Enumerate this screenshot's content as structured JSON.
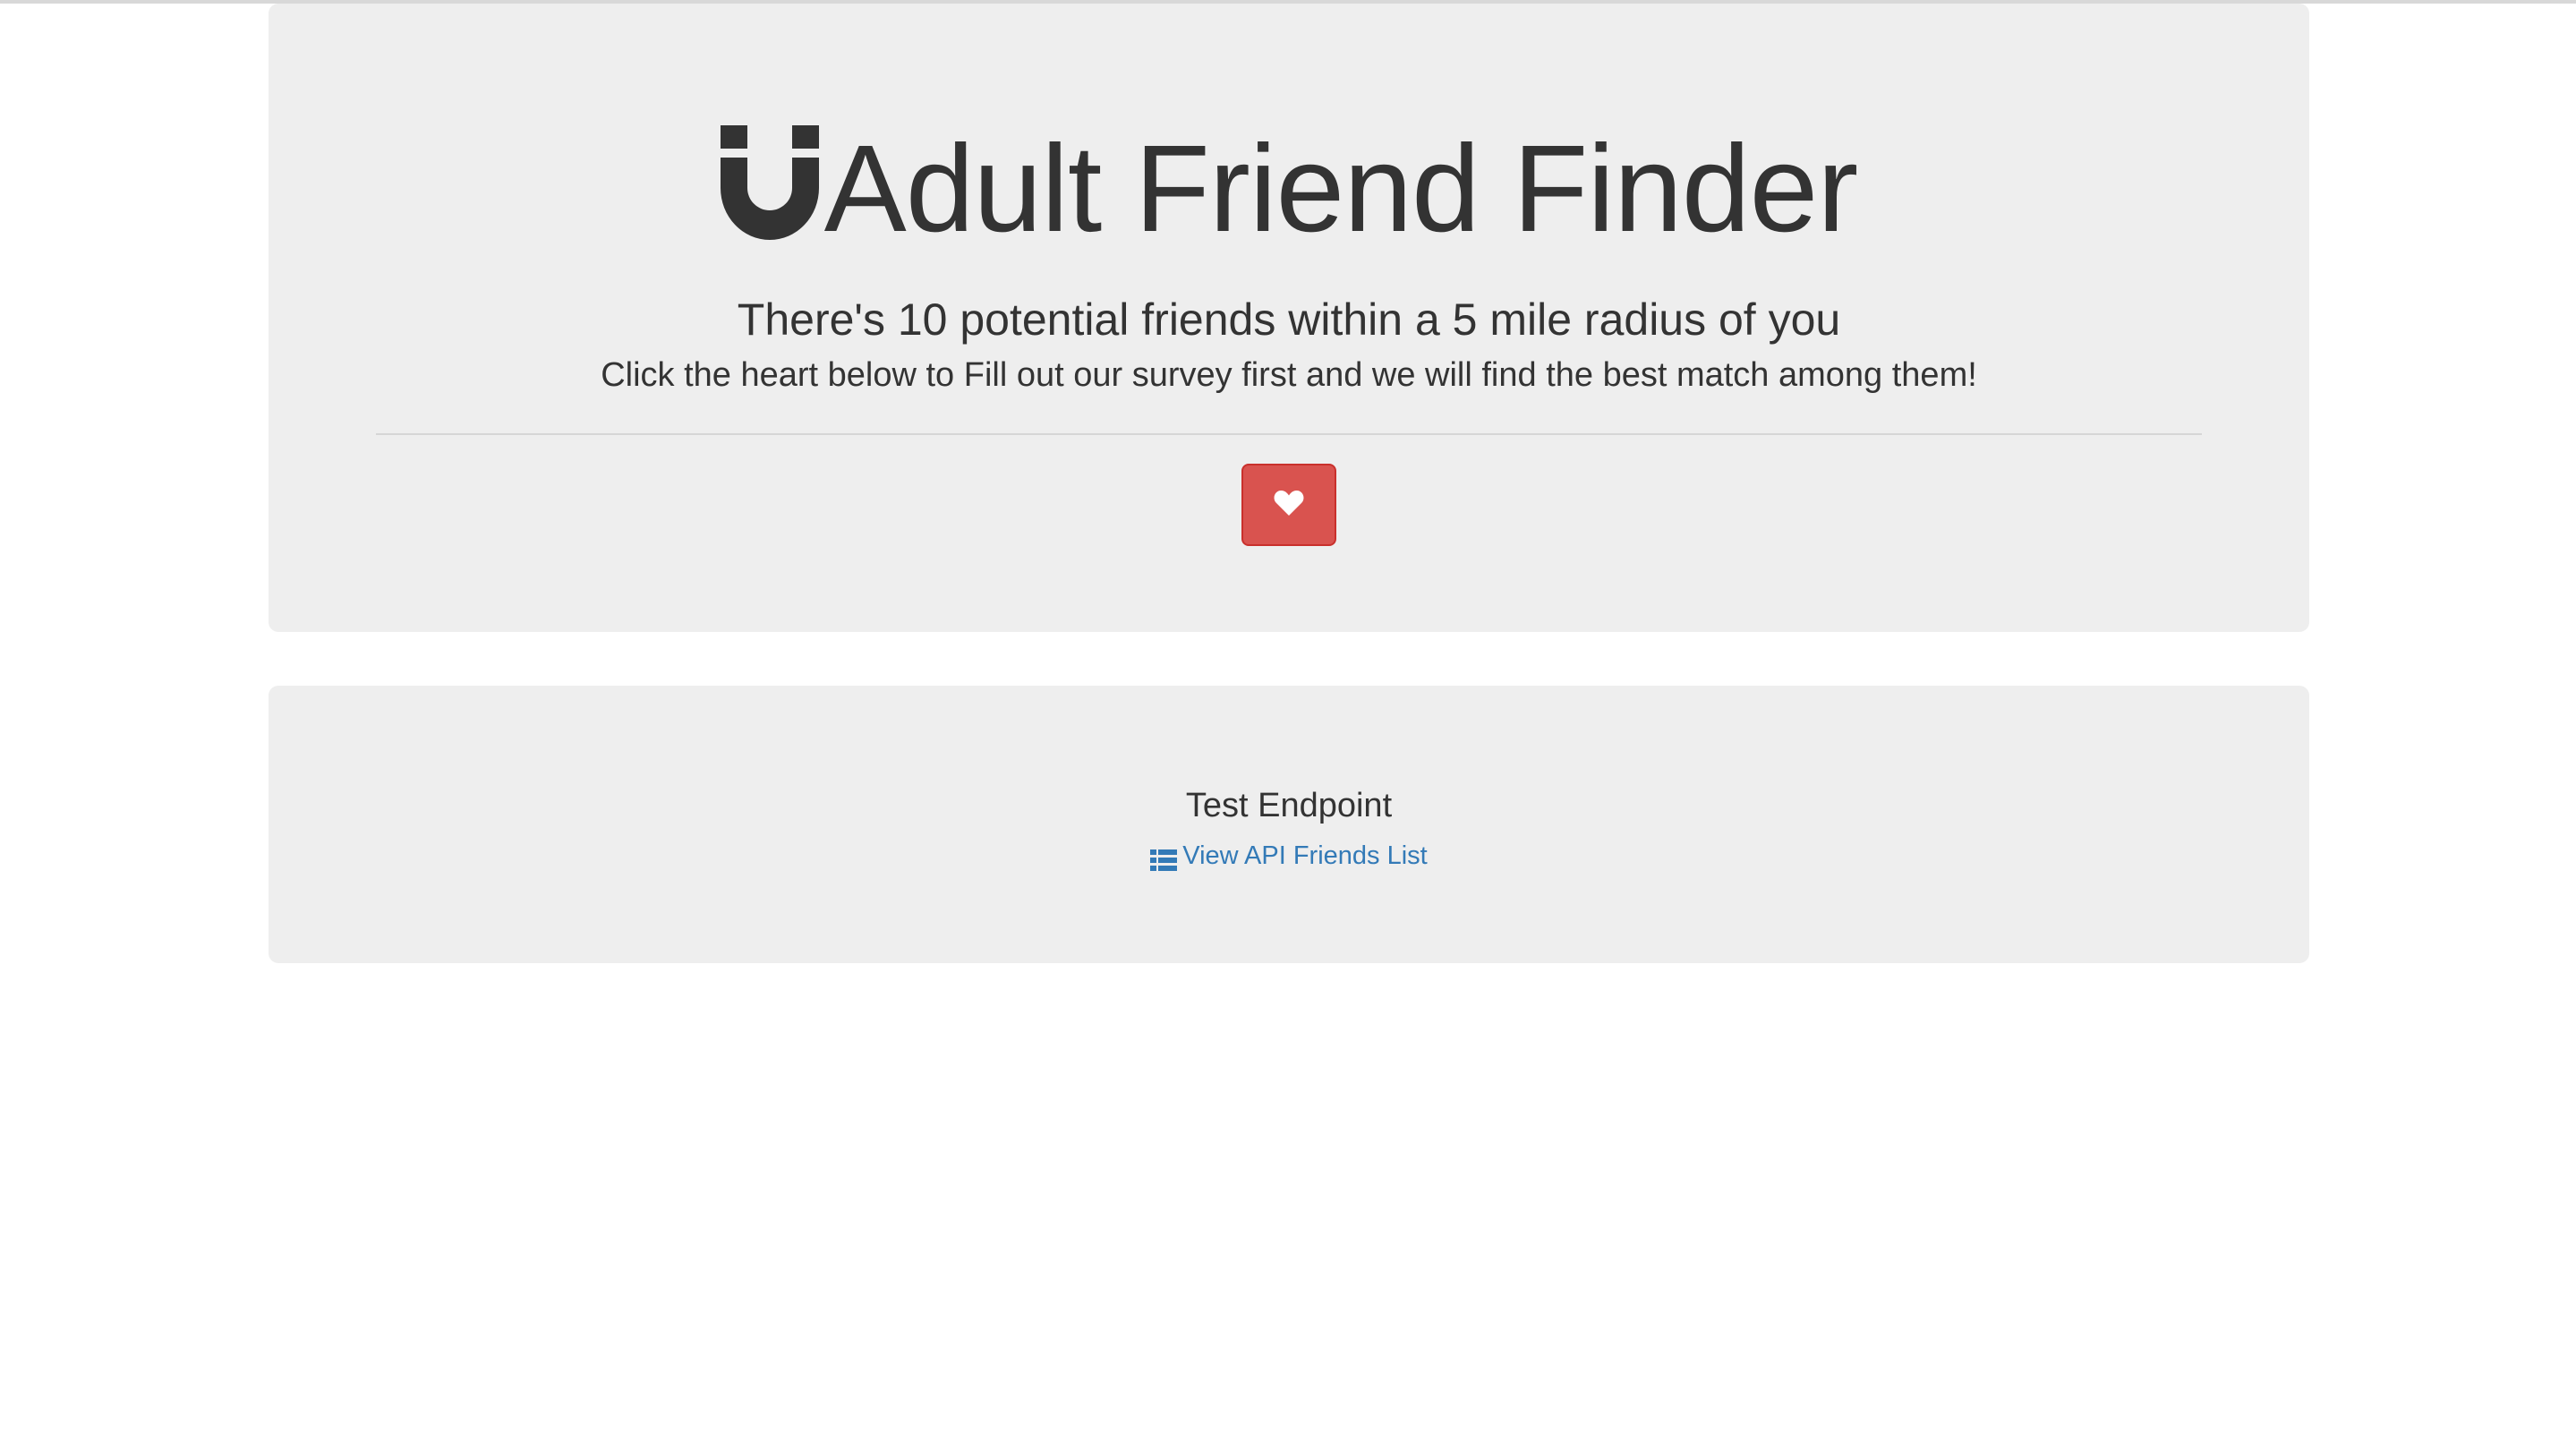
{
  "header": {
    "title": "Adult Friend Finder",
    "subtitle": "There's 10 potential friends within a 5 mile radius of you",
    "lead": "Click the heart below to Fill out our survey first and we will find the best match among them!",
    "logo_icon": "magnet-icon",
    "button_icon": "heart-icon"
  },
  "test_panel": {
    "title": "Test Endpoint",
    "link_label": "View API Friends List",
    "link_icon": "list-icon"
  },
  "colors": {
    "jumbotron_bg": "#eeeeee",
    "button_danger": "#d9534f",
    "link": "#337ab7",
    "text": "#333333"
  }
}
